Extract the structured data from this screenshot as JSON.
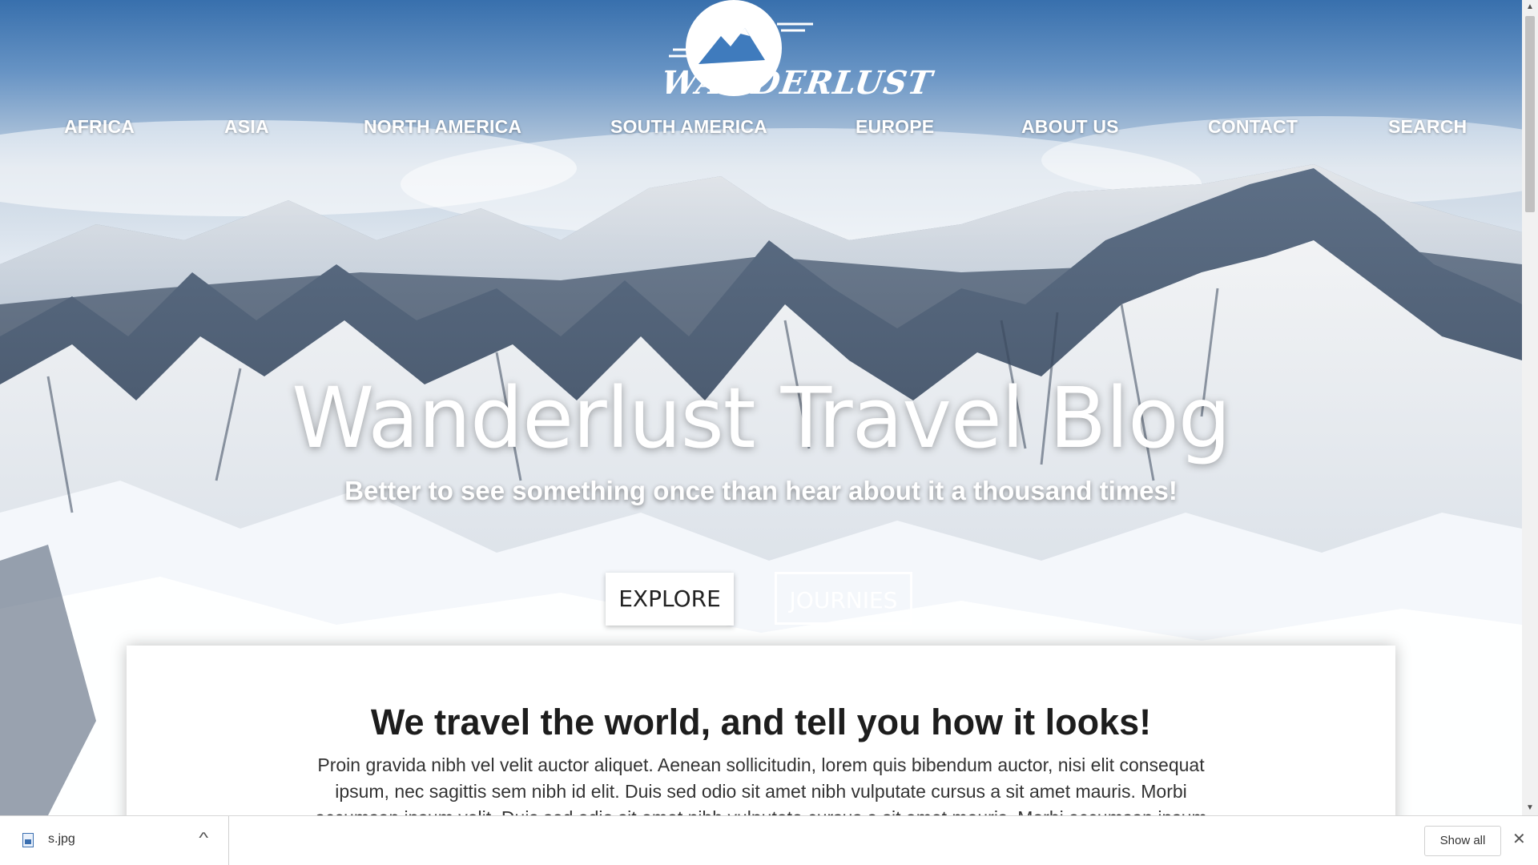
{
  "site": {
    "logo_text": "WANDERLUST"
  },
  "nav": {
    "items": [
      "AFRICA",
      "ASIA",
      "NORTH AMERICA",
      "SOUTH AMERICA",
      "EUROPE",
      "ABOUT US",
      "CONTACT",
      "SEARCH"
    ]
  },
  "hero": {
    "title": "Wanderlust Travel Blog",
    "subtitle": "Better to see something once than hear about it a thousand times!",
    "explore_label": "EXPLORE",
    "journies_label": "JOURNIES"
  },
  "content": {
    "heading": "We travel the world, and tell you how it looks!",
    "body": "Proin gravida nibh vel velit auctor aliquet. Aenean sollicitudin, lorem quis bibendum auctor, nisi elit consequat ipsum, nec sagittis sem nibh id elit. Duis sed odio sit amet nibh vulputate cursus a sit amet mauris. Morbi accumsan ipsum velit. Duis sed odio sit amet nibh vulputate cursus a sit amet mauris. Morbi accumsan ipsum velit. Nam nec"
  },
  "download_bar": {
    "filename": "s.jpg",
    "show_all_label": "Show all",
    "file_icon": "image-file-icon",
    "chevron_icon": "chevron-up-icon",
    "close_icon": "close-icon"
  },
  "colors": {
    "sky": "#3f7bbd",
    "button_bg": "#ffffff",
    "text_dark": "#1d1d1d"
  }
}
